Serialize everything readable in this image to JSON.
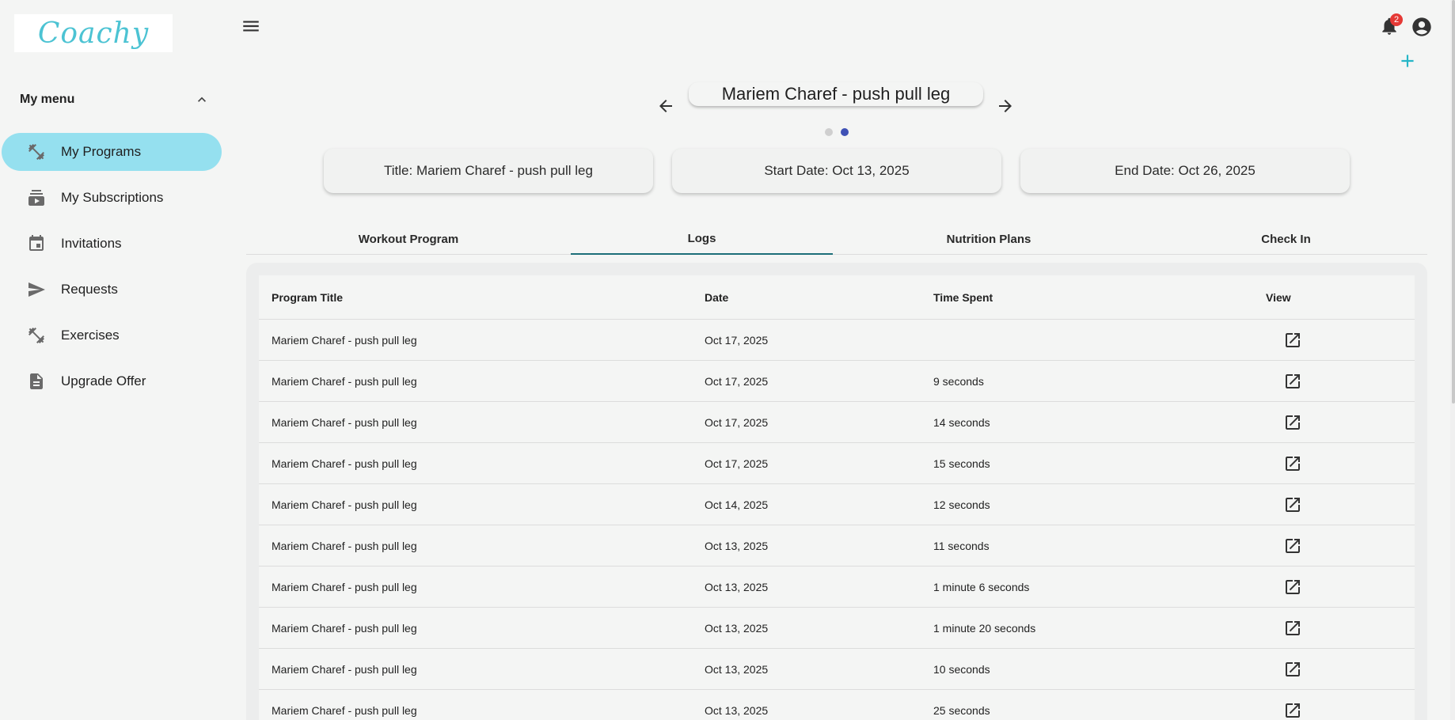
{
  "brand": {
    "logo_text": "Coachy"
  },
  "sidebar": {
    "menu_title": "My menu",
    "items": [
      {
        "label": "My Programs",
        "icon": "fitness-icon",
        "active": true
      },
      {
        "label": "My Subscriptions",
        "icon": "subscriptions-icon",
        "active": false
      },
      {
        "label": "Invitations",
        "icon": "calendar-icon",
        "active": false
      },
      {
        "label": "Requests",
        "icon": "send-icon",
        "active": false
      },
      {
        "label": "Exercises",
        "icon": "fitness-icon",
        "active": false
      },
      {
        "label": "Upgrade Offer",
        "icon": "document-icon",
        "active": false
      }
    ]
  },
  "header": {
    "notification_count": "2"
  },
  "program": {
    "carousel_title": "Mariem Charef - push pull leg",
    "title_card": "Title: Mariem Charef - push pull leg",
    "start_card": "Start Date: Oct 13, 2025",
    "end_card": "End Date: Oct 26, 2025"
  },
  "tabs": [
    "Workout Program",
    "Logs",
    "Nutrition Plans",
    "Check In"
  ],
  "active_tab": "Logs",
  "table": {
    "headers": [
      "Program Title",
      "Date",
      "Time Spent",
      "View"
    ],
    "rows": [
      [
        "Mariem Charef - push pull leg",
        "Oct 17, 2025",
        ""
      ],
      [
        "Mariem Charef - push pull leg",
        "Oct 17, 2025",
        "9 seconds"
      ],
      [
        "Mariem Charef - push pull leg",
        "Oct 17, 2025",
        "14 seconds"
      ],
      [
        "Mariem Charef - push pull leg",
        "Oct 17, 2025",
        "15 seconds"
      ],
      [
        "Mariem Charef - push pull leg",
        "Oct 14, 2025",
        "12 seconds"
      ],
      [
        "Mariem Charef - push pull leg",
        "Oct 13, 2025",
        "11 seconds"
      ],
      [
        "Mariem Charef - push pull leg",
        "Oct 13, 2025",
        "1 minute 6 seconds"
      ],
      [
        "Mariem Charef - push pull leg",
        "Oct 13, 2025",
        "1 minute 20 seconds"
      ],
      [
        "Mariem Charef - push pull leg",
        "Oct 13, 2025",
        "10 seconds"
      ],
      [
        "Mariem Charef - push pull leg",
        "Oct 13, 2025",
        "25 seconds"
      ]
    ]
  },
  "colors": {
    "accent": "#95e0ef",
    "tab_indicator": "#1c6e78",
    "plus": "#26b6c7",
    "dot_active": "#3f51b5"
  }
}
